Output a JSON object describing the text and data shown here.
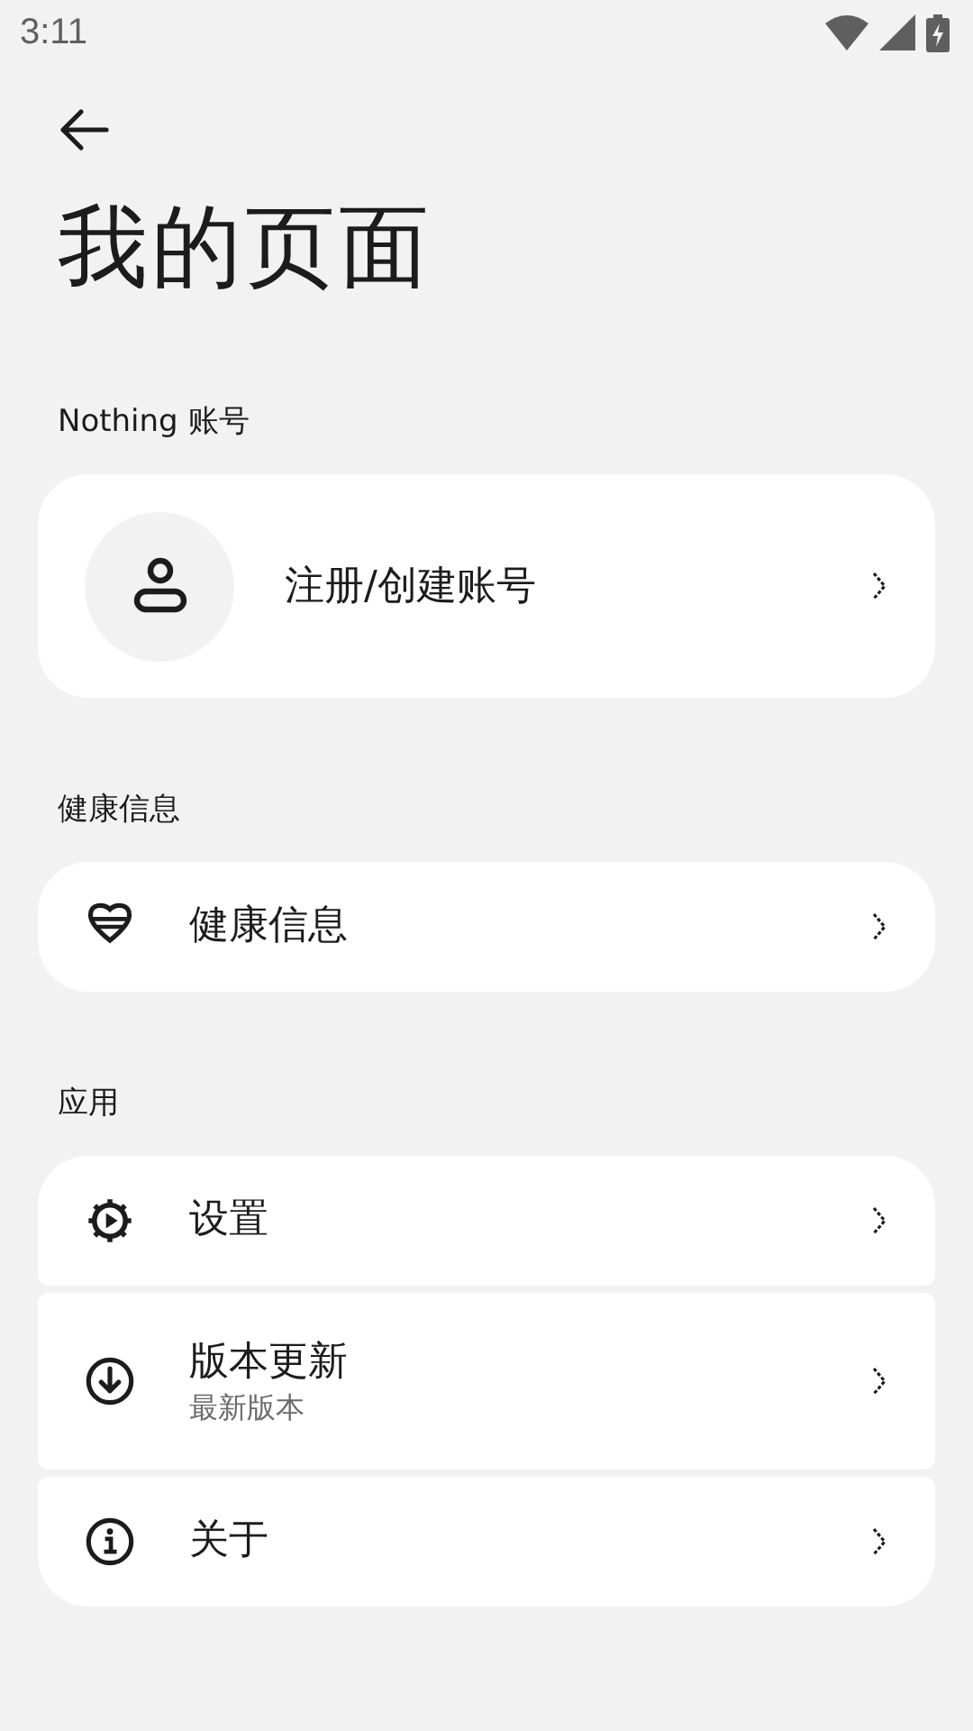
{
  "status_bar": {
    "time": "3:11"
  },
  "title": "我的页面",
  "sections": [
    {
      "label": "Nothing 账号",
      "items": [
        {
          "kind": "account",
          "label": "注册/创建账号"
        }
      ]
    },
    {
      "label": "健康信息",
      "items": [
        {
          "kind": "row",
          "label": "健康信息"
        }
      ]
    },
    {
      "label": "应用",
      "items": [
        {
          "kind": "row",
          "label": "设置"
        },
        {
          "kind": "row",
          "label": "版本更新",
          "subtitle": "最新版本"
        },
        {
          "kind": "row",
          "label": "关于"
        }
      ]
    }
  ]
}
